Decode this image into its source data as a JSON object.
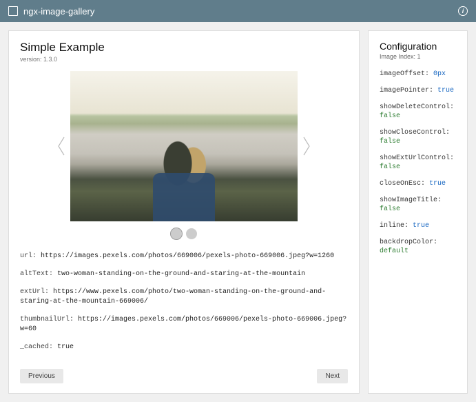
{
  "topbar": {
    "title": "ngx-image-gallery"
  },
  "main": {
    "heading": "Simple Example",
    "version_label": "version: 1.3.0",
    "props": [
      {
        "label": "url:",
        "value": "https://images.pexels.com/photos/669006/pexels-photo-669006.jpeg?w=1260"
      },
      {
        "label": "altText:",
        "value": "two-woman-standing-on-the-ground-and-staring-at-the-mountain"
      },
      {
        "label": "extUrl:",
        "value": "https://www.pexels.com/photo/two-woman-standing-on-the-ground-and-staring-at-the-mountain-669006/"
      },
      {
        "label": "thumbnailUrl:",
        "value": "https://images.pexels.com/photos/669006/pexels-photo-669006.jpeg?w=60"
      },
      {
        "label": "_cached:",
        "value": "true"
      }
    ],
    "buttons": {
      "prev": "Previous",
      "next": "Next"
    }
  },
  "config": {
    "heading": "Configuration",
    "index_label": "Image Index:",
    "index_value": "1",
    "items": [
      {
        "key": "imageOffset:",
        "value": "0px",
        "blue": true
      },
      {
        "key": "imagePointer:",
        "value": "true",
        "blue": true
      },
      {
        "key": "showDeleteControl:",
        "value": "false",
        "green": true
      },
      {
        "key": "showCloseControl:",
        "value": "false",
        "green": true
      },
      {
        "key": "showExtUrlControl:",
        "value": "false",
        "green": true
      },
      {
        "key": "closeOnEsc:",
        "value": "true",
        "blue": true
      },
      {
        "key": "showImageTitle:",
        "value": "false",
        "green": true
      },
      {
        "key": "inline:",
        "value": "true",
        "blue": true
      },
      {
        "key": "backdropColor:",
        "value": "default",
        "green": true
      }
    ]
  }
}
